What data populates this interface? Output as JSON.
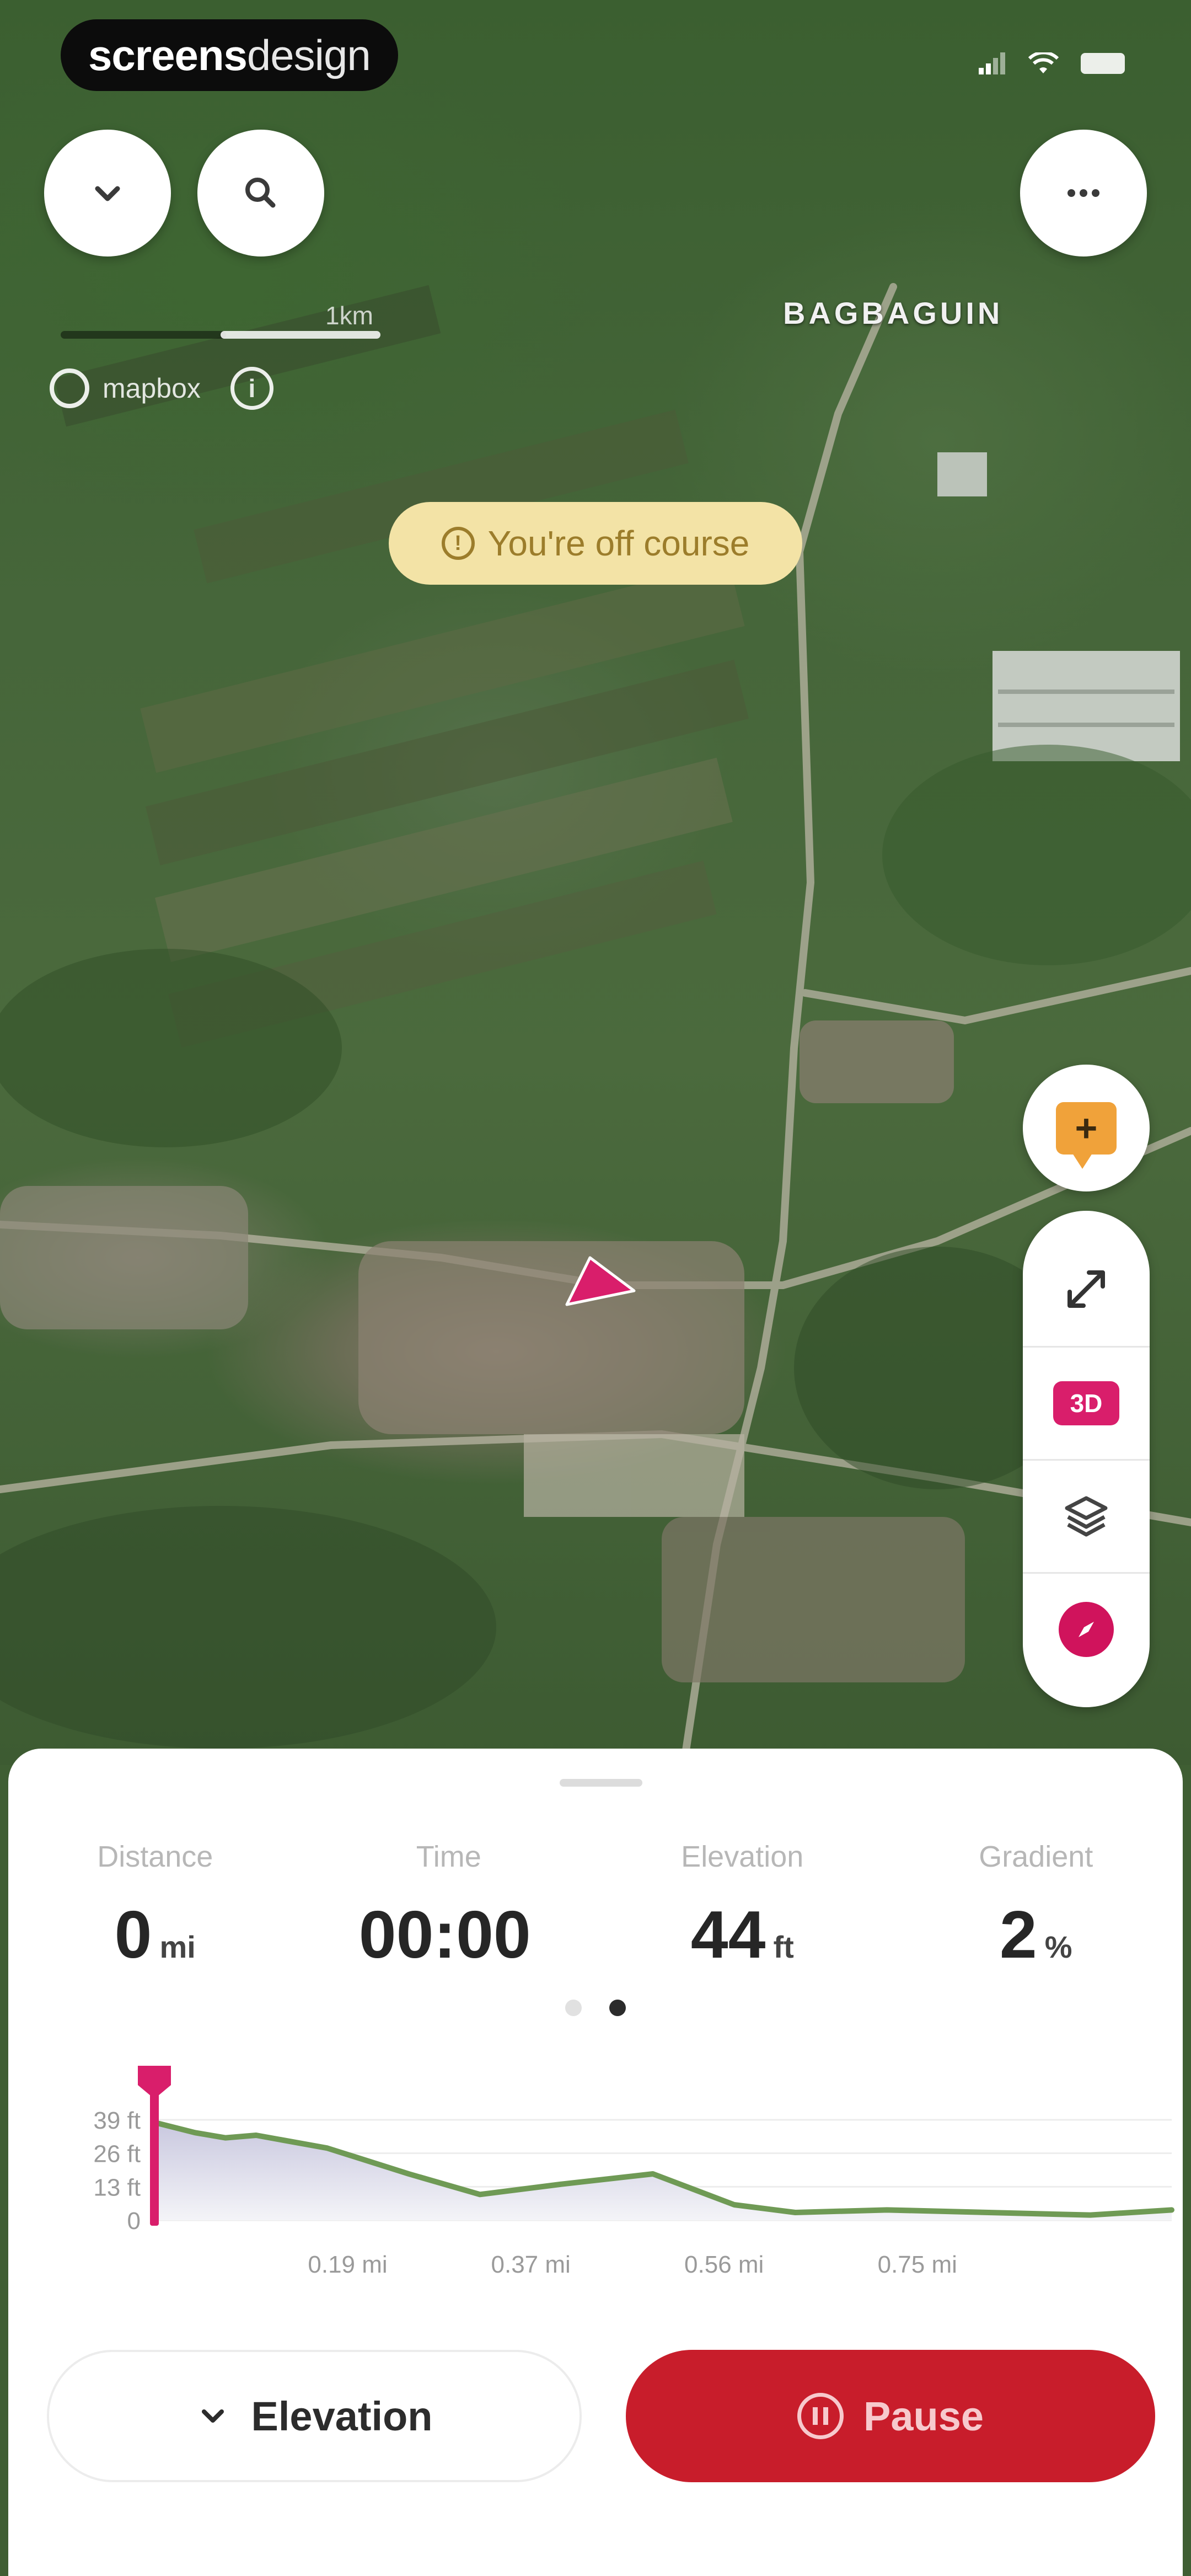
{
  "brand": {
    "part1": "screens",
    "part2": "design"
  },
  "map": {
    "scale_label": "1km",
    "attribution": "mapbox",
    "info_glyph": "i",
    "place_label": "BAGBAGUIN",
    "off_course": "You're off course",
    "warn_glyph": "!"
  },
  "toolbar": {
    "collapse_icon": "chevron-down-icon",
    "search_icon": "search-icon",
    "more_icon": "more-horizontal-icon",
    "report_glyph": "+",
    "tool_3d": "3D"
  },
  "stats": [
    {
      "label": "Distance",
      "value": "0",
      "unit": "mi"
    },
    {
      "label": "Time",
      "value": "00:00",
      "unit": ""
    },
    {
      "label": "Elevation",
      "value": "44",
      "unit": "ft"
    },
    {
      "label": "Gradient",
      "value": "2",
      "unit": "%"
    }
  ],
  "pager": {
    "count": 2,
    "active": 1
  },
  "buttons": {
    "elevation": "Elevation",
    "pause": "Pause"
  },
  "colors": {
    "accent": "#c81d2b",
    "route": "#d91e6b",
    "profile_line": "#6f9a55",
    "off_course_bg": "#f3e3a6"
  },
  "chart_data": {
    "type": "area",
    "title": "",
    "xlabel": "",
    "ylabel": "",
    "x_ticks": [
      "0.19 mi",
      "0.37 mi",
      "0.56 mi",
      "0.75 mi"
    ],
    "y_ticks": [
      "39 ft",
      "26 ft",
      "13 ft",
      "0"
    ],
    "ylim": [
      0,
      45
    ],
    "xlim": [
      0,
      1.0
    ],
    "current_position": 0,
    "series": [
      {
        "x": [
          0,
          0.04,
          0.07,
          0.1,
          0.17,
          0.25,
          0.32,
          0.4,
          0.49,
          0.57,
          0.63,
          0.72,
          0.82,
          0.92,
          1.0
        ],
        "values": [
          38,
          34,
          32,
          33,
          28,
          18,
          10,
          14,
          18,
          6,
          3,
          4,
          3,
          2,
          4
        ]
      }
    ]
  }
}
